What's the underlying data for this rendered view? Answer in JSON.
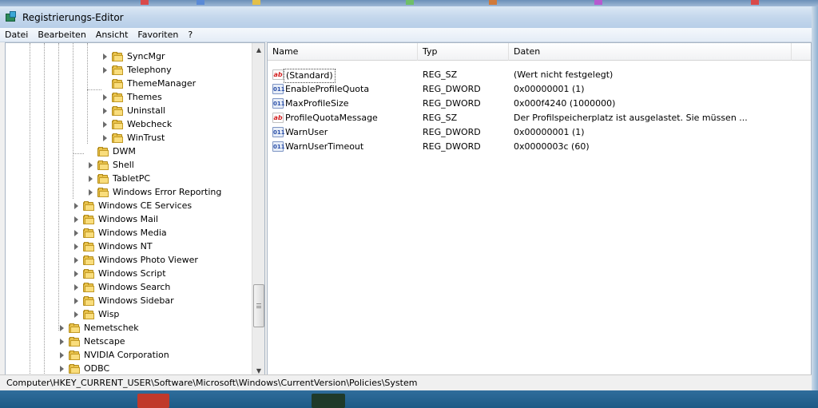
{
  "window": {
    "title": "Registrierungs-Editor"
  },
  "menu": [
    "Datei",
    "Bearbeiten",
    "Ansicht",
    "Favoriten",
    "?"
  ],
  "tree": {
    "items": [
      {
        "label": "SyncMgr",
        "level": 3,
        "expander": "arrow"
      },
      {
        "label": "Telephony",
        "level": 3,
        "expander": "arrow"
      },
      {
        "label": "ThemeManager",
        "level": 3,
        "expander": "none"
      },
      {
        "label": "Themes",
        "level": 3,
        "expander": "arrow"
      },
      {
        "label": "Uninstall",
        "level": 3,
        "expander": "arrow"
      },
      {
        "label": "Webcheck",
        "level": 3,
        "expander": "arrow"
      },
      {
        "label": "WinTrust",
        "level": 3,
        "expander": "arrow"
      },
      {
        "label": "DWM",
        "level": 2,
        "expander": "none"
      },
      {
        "label": "Shell",
        "level": 2,
        "expander": "arrow"
      },
      {
        "label": "TabletPC",
        "level": 2,
        "expander": "arrow"
      },
      {
        "label": "Windows Error Reporting",
        "level": 2,
        "expander": "arrow"
      },
      {
        "label": "Windows CE Services",
        "level": 1,
        "expander": "arrow"
      },
      {
        "label": "Windows Mail",
        "level": 1,
        "expander": "arrow"
      },
      {
        "label": "Windows Media",
        "level": 1,
        "expander": "arrow"
      },
      {
        "label": "Windows NT",
        "level": 1,
        "expander": "arrow"
      },
      {
        "label": "Windows Photo Viewer",
        "level": 1,
        "expander": "arrow"
      },
      {
        "label": "Windows Script",
        "level": 1,
        "expander": "arrow"
      },
      {
        "label": "Windows Search",
        "level": 1,
        "expander": "arrow"
      },
      {
        "label": "Windows Sidebar",
        "level": 1,
        "expander": "arrow"
      },
      {
        "label": "Wisp",
        "level": 1,
        "expander": "arrow"
      },
      {
        "label": "Nemetschek",
        "level": 0,
        "expander": "arrow"
      },
      {
        "label": "Netscape",
        "level": 0,
        "expander": "arrow"
      },
      {
        "label": "NVIDIA Corporation",
        "level": 0,
        "expander": "arrow"
      },
      {
        "label": "ODBC",
        "level": 0,
        "expander": "arrow"
      }
    ]
  },
  "list": {
    "columns": [
      "Name",
      "Typ",
      "Daten"
    ],
    "rows": [
      {
        "icon": "string-value-icon",
        "name": "(Standard)",
        "type": "REG_SZ",
        "data": "(Wert nicht festgelegt)",
        "selected": true
      },
      {
        "icon": "binary-value-icon",
        "name": "EnableProfileQuota",
        "type": "REG_DWORD",
        "data": "0x00000001 (1)"
      },
      {
        "icon": "binary-value-icon",
        "name": "MaxProfileSize",
        "type": "REG_DWORD",
        "data": "0x000f4240 (1000000)"
      },
      {
        "icon": "string-value-icon",
        "name": "ProfileQuotaMessage",
        "type": "REG_SZ",
        "data": "Der Profilspeicherplatz ist ausgelastet. Sie müssen ..."
      },
      {
        "icon": "binary-value-icon",
        "name": "WarnUser",
        "type": "REG_DWORD",
        "data": "0x00000001 (1)"
      },
      {
        "icon": "binary-value-icon",
        "name": "WarnUserTimeout",
        "type": "REG_DWORD",
        "data": "0x0000003c (60)"
      }
    ]
  },
  "status": {
    "path": "Computer\\HKEY_CURRENT_USER\\Software\\Microsoft\\Windows\\CurrentVersion\\Policies\\System"
  },
  "icons": {
    "string_value": "ab",
    "binary_value": "011"
  },
  "colors": {
    "titlebar": "#c4d7ec",
    "folder": "#e9c24a",
    "taskbar": "#2f6d9c"
  }
}
